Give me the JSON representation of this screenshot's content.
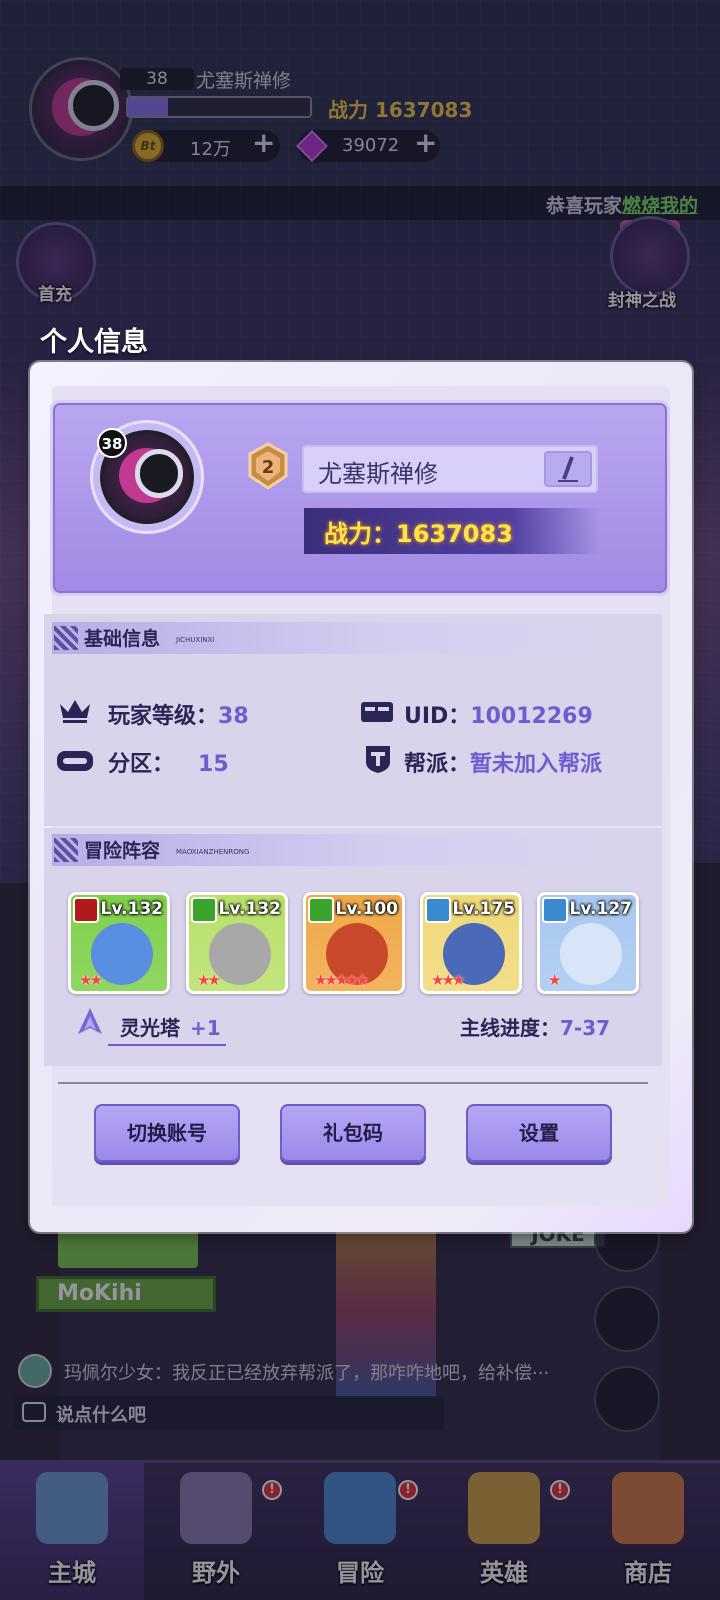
{
  "hud": {
    "level": "38",
    "name": "尤塞斯禅修",
    "power": "战力 1637083",
    "xp_fraction": 0.22,
    "coin_icon": "Bt",
    "coin_value": "12万",
    "gem_value": "39072",
    "plus": "+"
  },
  "announcement": {
    "prefix": "恭喜玩家",
    "link": "燃烧我的"
  },
  "side_events": {
    "left_top": "首充",
    "right_top": "封神之战"
  },
  "modal": {
    "title": "个人信息",
    "profile": {
      "level_badge": "38",
      "rank": "2",
      "name": "尤塞斯禅修",
      "power": "战力：1637083"
    },
    "basic_info": {
      "title": "基础信息",
      "subtitle": "JICHUXINXI",
      "player_level_label": "玩家等级：",
      "player_level": "38",
      "uid_label": "UID：",
      "uid": "10012269",
      "server_label": "分区：",
      "server": "15",
      "guild_label": "帮派：",
      "guild": "暂未加入帮派"
    },
    "lineup": {
      "title": "冒险阵容",
      "subtitle": "MAOXIANZHENRONG",
      "heroes": [
        {
          "level": "Lv.132",
          "stars": "★★",
          "badge_color": "#b01a1a",
          "bg": "#7fd04a",
          "face": "#5a8ee0"
        },
        {
          "level": "Lv.132",
          "stars": "★★",
          "badge_color": "#3aa52a",
          "bg": "#b8e06a",
          "face": "#a8a8a8"
        },
        {
          "level": "Lv.100",
          "stars": "★★★★★",
          "badge_color": "#3aa52a",
          "bg": "#f0a848",
          "face": "#c84a2a"
        },
        {
          "level": "Lv.175",
          "stars": "★★★",
          "badge_color": "#3a8ad0",
          "bg": "#f0d878",
          "face": "#4a6ab8"
        },
        {
          "level": "Lv.127",
          "stars": "★",
          "badge_color": "#3a8ad0",
          "bg": "#a8c8f0",
          "face": "#d8e4f8"
        }
      ],
      "tower_label": "灵光塔",
      "tower_value": "+1",
      "progress_label": "主线进度：",
      "progress_value": "7-37"
    },
    "buttons": {
      "switch_account": "切换账号",
      "gift_code": "礼包码",
      "settings": "设置"
    }
  },
  "scene_signs": {
    "mokihi": "MoKihi",
    "joker": "JOKE"
  },
  "chat": {
    "message": "玛佩尔少女：我反正已经放弃帮派了，那咋咋地吧，给补偿···",
    "input_placeholder": "说点什么吧"
  },
  "nav": [
    {
      "label": "主城",
      "color": "#6a9ad0"
    },
    {
      "label": "野外",
      "color": "#8a7ab0"
    },
    {
      "label": "冒险",
      "color": "#4a8ad0"
    },
    {
      "label": "英雄",
      "color": "#d0a040"
    },
    {
      "label": "商店",
      "color": "#d07a40"
    }
  ],
  "nav_badge": "!",
  "colors": {
    "accent": "#6c5ed0",
    "power_gold": "#ffe34a",
    "panel": "#e5e1f2"
  }
}
